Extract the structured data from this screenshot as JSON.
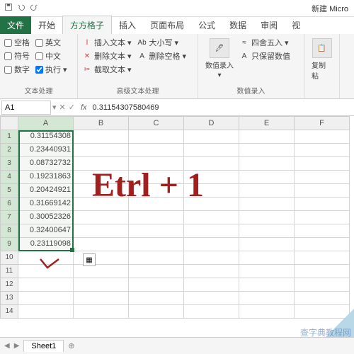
{
  "title": "新建 Micro",
  "tabs": {
    "file": "文件",
    "t1": "开始",
    "t2": "方方格子",
    "t3": "插入",
    "t4": "页面布局",
    "t5": "公式",
    "t6": "数据",
    "t7": "审阅",
    "t8": "视"
  },
  "g1": {
    "label": "文本处理",
    "c1": "空格",
    "c2": "英文",
    "c3": "符号",
    "c4": "中文",
    "c5": "数字",
    "c6": "执行"
  },
  "g2": {
    "label": "高级文本处理",
    "i1": "插入文本",
    "i2": "删除文本",
    "i3": "截取文本",
    "i4": "大小写",
    "i5": "删除空格"
  },
  "g3": {
    "label": "数值录入",
    "b1": "数值录入",
    "i1": "四舍五入",
    "i2": "只保留数值",
    "b2": "复制粘"
  },
  "namebox": "A1",
  "formula": "0.31154307580469",
  "cols": [
    "A",
    "B",
    "C",
    "D",
    "E",
    "F"
  ],
  "rows": [
    "1",
    "2",
    "3",
    "4",
    "5",
    "6",
    "7",
    "8",
    "9",
    "10",
    "11",
    "12",
    "13",
    "14"
  ],
  "cells": {
    "0": "0.31154308",
    "1": "0.23440931",
    "2": "0.08732732",
    "3": "0.19231863",
    "4": "0.20424921",
    "5": "0.31669142",
    "6": "0.30052326",
    "7": "0.32400647",
    "8": "0.23119098"
  },
  "sheet": "Sheet1",
  "annotation": "Etrl + 1",
  "watermark": "查字典教程网"
}
